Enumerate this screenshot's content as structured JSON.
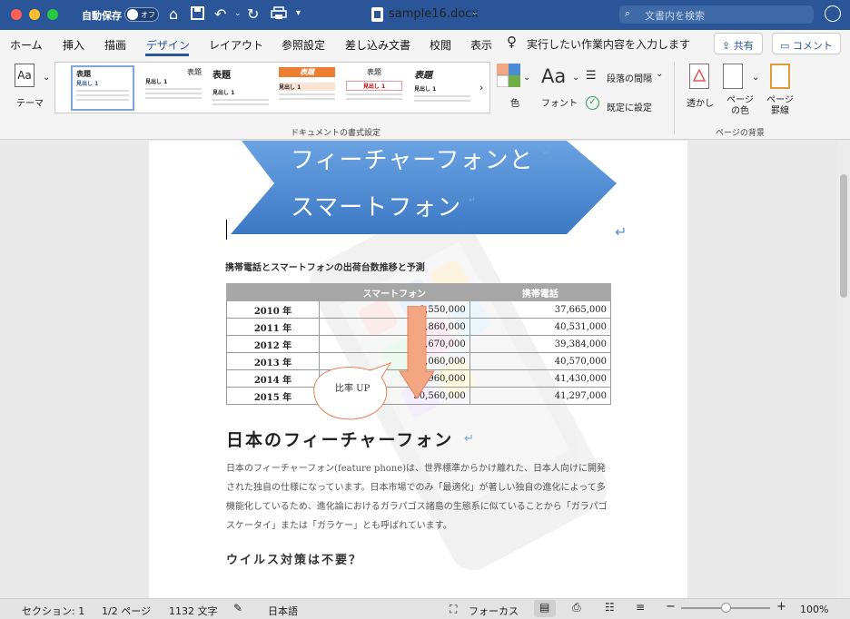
{
  "titlebar": {
    "autosave_label": "自動保存",
    "autosave_state": "オフ",
    "doc_title": "sample16.docx",
    "search_placeholder": "文書内を検索",
    "icons": [
      "home-icon",
      "save-icon",
      "undo-icon",
      "redo-icon",
      "print-icon",
      "customize-icon",
      "search-icon",
      "smiley-icon"
    ]
  },
  "tabs": [
    "ホーム",
    "挿入",
    "描画",
    "デザイン",
    "レイアウト",
    "参照設定",
    "差し込み文書",
    "校閲",
    "表示"
  ],
  "active_tab": "デザイン",
  "tellme": "実行したい作業内容を入力します",
  "share_label": "共有",
  "comment_label": "コメント",
  "ribbon": {
    "theme_label": "テーマ",
    "styles": [
      {
        "title": "表題",
        "heading": "見出し 1"
      },
      {
        "title": "表題",
        "heading": "見出し 1"
      },
      {
        "title": "表題",
        "heading": "見出し 1"
      },
      {
        "title": "表題",
        "heading": "見出し 1"
      },
      {
        "title": "表題",
        "heading": "見出し 1"
      },
      {
        "title": "表題",
        "heading": "見出し 1"
      }
    ],
    "color_label": "色",
    "font_label": "フォント",
    "font_icon_text": "Aa",
    "paragraph_spacing_label": "段落の間隔",
    "set_default_label": "既定に設定",
    "group_format_label": "ドキュメントの書式設定",
    "watermark_label": "透かし",
    "page_color_label": "ページの色",
    "page_border_label": "ページ罫線",
    "group_bg_label": "ページの背景"
  },
  "document": {
    "banner_line1": "フィーチャーフォンと",
    "banner_line2": "スマートフォン",
    "table_caption": "携帯電話とスマートフォンの出荷台数推移と予測",
    "table_headers": [
      "",
      "スマートフォン",
      "携帯電話"
    ],
    "table_rows": [
      [
        "2010 年",
        "8,550,000",
        "37,665,000"
      ],
      [
        "2011 年",
        "19,860,000",
        "40,531,000"
      ],
      [
        "2012 年",
        "23,670,000",
        "39,384,000"
      ],
      [
        "2013 年",
        "27,060,000",
        "40,570,000"
      ],
      [
        "2014 年",
        "28,960,000",
        "41,430,000"
      ],
      [
        "2015 年",
        "30,560,000",
        "41,297,000"
      ]
    ],
    "callout_text": "比率 UP",
    "heading1": "日本のフィーチャーフォン",
    "paragraph": "日本のフィーチャーフォン(feature phone)は、世界標準からかけ離れた、日本人向けに開発された独自の仕様になっています。日本市場でのみ「最適化」が著しい独自の進化によって多機能化しているため、進化論におけるガラパゴス諸島の生態系に似ていることから「ガラパゴスケータイ」または「ガラケー」とも呼ばれています。",
    "heading2": "ウイルス対策は不要？"
  },
  "status": {
    "section": "セクション: 1",
    "page": "1/2 ページ",
    "words": "1132 文字",
    "language": "日本語",
    "focus": "フォーカス",
    "zoom": "100%"
  },
  "colors": {
    "titlebar": "#2a5699",
    "banner": "#4a8bd6",
    "arrow": "#f4a582",
    "table_header": "#a6a6a6"
  }
}
